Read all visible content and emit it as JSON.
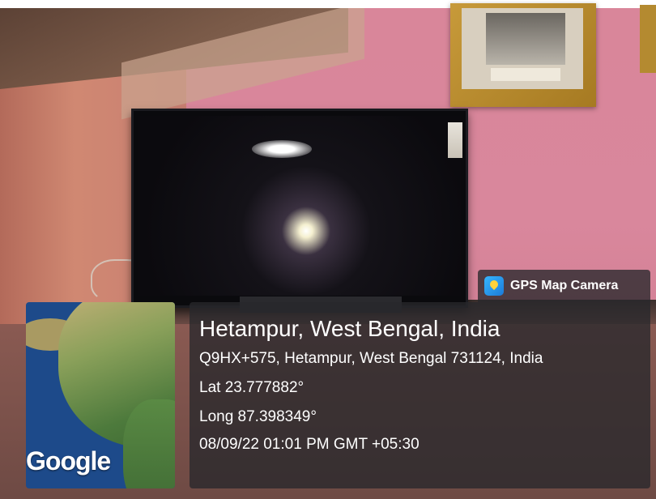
{
  "overlay": {
    "app_name": "GPS Map Camera",
    "app_icon": "gps-map-camera-icon",
    "location_title": "Hetampur, West Bengal, India",
    "address": "Q9HX+575, Hetampur, West Bengal 731124, India",
    "latitude": "Lat 23.777882°",
    "longitude": "Long 87.398349°",
    "datetime": "08/09/22 01:01 PM GMT +05:30",
    "map_logo": "Google"
  },
  "colors": {
    "overlay_bg": "#28282c",
    "wall_pink": "#d9869a",
    "frame_gold": "#c79a3a"
  }
}
